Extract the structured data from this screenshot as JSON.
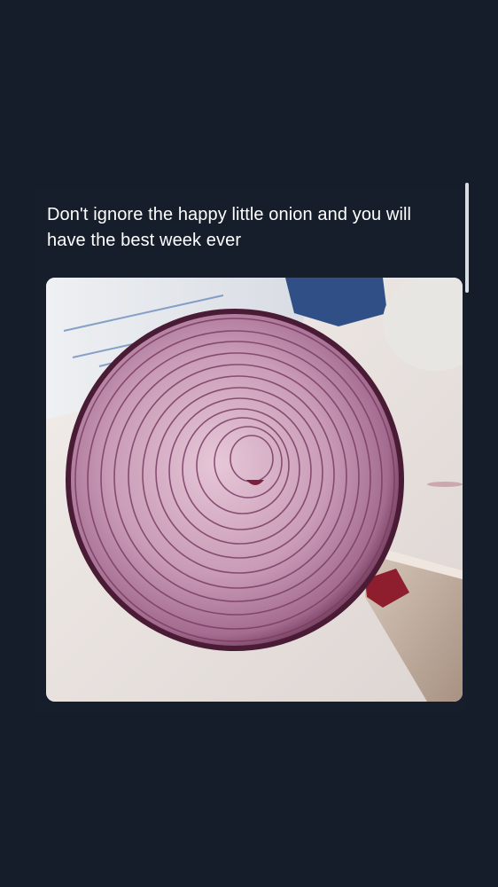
{
  "post": {
    "text": "Don't ignore the happy little onion and you will have the best week ever"
  },
  "media": {
    "alt_icon": "photo-onion-slice",
    "colors": {
      "background": "#141d29",
      "onion_outer": "#5e2a45",
      "onion_inner": "#d3aac3",
      "board": "#e8e2df"
    }
  }
}
